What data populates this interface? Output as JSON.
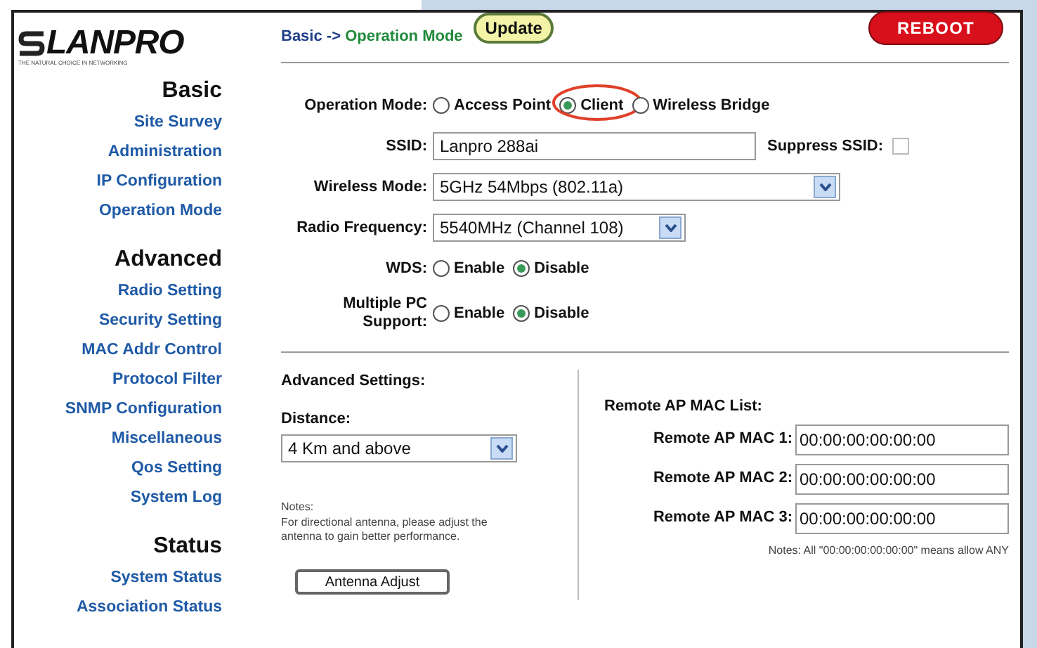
{
  "logo": {
    "name": "LANPRO",
    "tagline": "THE NATURAL CHOICE IN NETWORKING"
  },
  "sidebar": [
    {
      "heading": "Basic",
      "items": [
        "Site Survey",
        "Administration",
        "IP Configuration",
        "Operation Mode"
      ]
    },
    {
      "heading": "Advanced",
      "items": [
        "Radio Setting",
        "Security Setting",
        "MAC Addr Control",
        "Protocol Filter",
        "SNMP Configuration",
        "Miscellaneous",
        "Qos Setting",
        "System Log"
      ]
    },
    {
      "heading": "Status",
      "items": [
        "System Status",
        "Association Status"
      ]
    }
  ],
  "breadcrumb": {
    "section": "Basic ->",
    "page": "Operation Mode"
  },
  "update_button": "Update",
  "reboot_button": "REBOOT",
  "form": [
    {
      "kind": "radio",
      "label": "Operation Mode:",
      "options": [
        {
          "label": "Access Point",
          "selected": false,
          "circled": false
        },
        {
          "label": "Client",
          "selected": true,
          "circled": true
        },
        {
          "label": "Wireless Bridge",
          "selected": false,
          "circled": false
        }
      ]
    },
    {
      "kind": "text",
      "label": "SSID:",
      "value": "Lanpro 288ai",
      "check": {
        "label": "Suppress SSID:",
        "checked": false
      }
    },
    {
      "kind": "select",
      "label": "Wireless Mode:",
      "value": "5GHz 54Mbps (802.11a)",
      "wide": true
    },
    {
      "kind": "select",
      "label": "Radio Frequency:",
      "value": "5540MHz (Channel 108)",
      "wide": false
    },
    {
      "kind": "radio",
      "label": "WDS:",
      "options": [
        {
          "label": "Enable",
          "selected": false,
          "circled": false
        },
        {
          "label": "Disable",
          "selected": true,
          "circled": false
        }
      ]
    },
    {
      "kind": "radio",
      "label": "Multiple PC Support:",
      "options": [
        {
          "label": "Enable",
          "selected": false,
          "circled": false
        },
        {
          "label": "Disable",
          "selected": true,
          "circled": false
        }
      ]
    }
  ],
  "advanced": {
    "title": "Advanced Settings:",
    "distance_label": "Distance:",
    "distance": "4 Km and above",
    "notes_title": "Notes:",
    "notes": "For directional antenna, please adjust the antenna to gain better performance.",
    "button": "Antenna Adjust"
  },
  "remote": {
    "title": "Remote AP MAC List:",
    "macs": [
      {
        "label": "Remote AP MAC 1:",
        "value": "00:00:00:00:00:00"
      },
      {
        "label": "Remote AP MAC 2:",
        "value": "00:00:00:00:00:00"
      },
      {
        "label": "Remote AP MAC 3:",
        "value": "00:00:00:00:00:00"
      }
    ],
    "note": "Notes: All \"00:00:00:00:00:00\" means allow ANY"
  }
}
